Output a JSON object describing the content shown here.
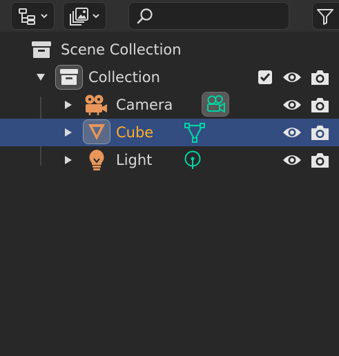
{
  "header": {
    "display_mode_icon": "outliner-tree-icon",
    "filter_mode_icon": "layers-image-icon",
    "search_value": "",
    "search_icon": "search-icon",
    "filter_icon": "funnel-icon"
  },
  "colors": {
    "background": "#282828",
    "header": "#303030",
    "selected_row": "#334d80",
    "selected_text": "#ffaf29",
    "object_icon": "#e8965a",
    "data_icon": "#00d4a3",
    "text": "#d9d9d9"
  },
  "rows": [
    {
      "label": "Scene Collection",
      "icon": "scene-collection-icon"
    },
    {
      "label": "Collection",
      "icon": "collection-icon",
      "expanded": true,
      "checkbox": true
    },
    {
      "label": "Camera",
      "icon": "camera-object-icon",
      "data_icon": "camera-data-icon",
      "selected": false
    },
    {
      "label": "Cube",
      "icon": "mesh-object-icon",
      "data_icon": "mesh-data-icon",
      "selected": true
    },
    {
      "label": "Light",
      "icon": "light-object-icon",
      "data_icon": "light-data-icon",
      "selected": false
    }
  ]
}
